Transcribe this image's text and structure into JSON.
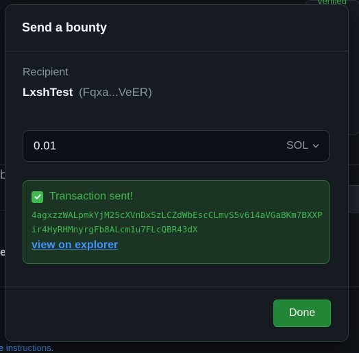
{
  "background": {
    "verified_label": "Verified",
    "left_fragment_1": "b",
    "left_fragment_2": "e",
    "right_button_fragment": "le",
    "footer_link_fragment": "e instructions."
  },
  "modal": {
    "title": "Send a bounty",
    "recipient": {
      "label": "Recipient",
      "name": "LxshTest",
      "address": "(Fqxa...VeER)"
    },
    "amount": {
      "value": "0.01",
      "currency": "SOL"
    },
    "result": {
      "status": "Transaction sent!",
      "tx_hash": "4agxzzWALpmkYjM25cXVnDxSzLCZdWbEscCLmvS5v614aVGaBKm7BXXPir4HyRHMnyrgFb8ALcm1u7FLcQBR43dX",
      "explorer_link": "view on explorer"
    },
    "done_label": "Done"
  },
  "colors": {
    "success": "#3fb950",
    "link": "#4493f8",
    "primary_button": "#238636"
  }
}
